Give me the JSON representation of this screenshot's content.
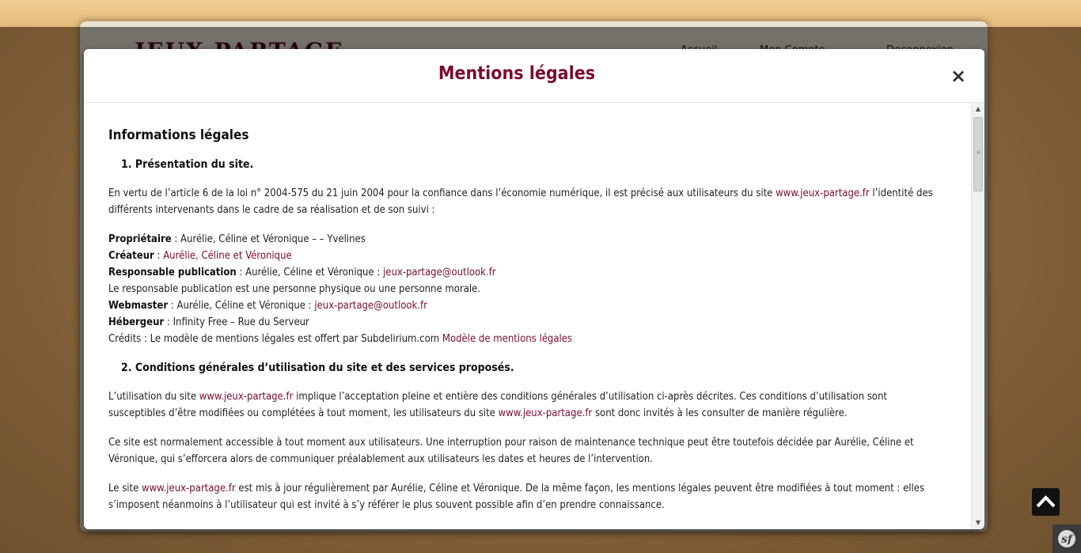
{
  "background": {
    "logo_text": "JEUX PARTAGE",
    "nav": [
      "Accueil",
      "Mon Compte",
      "Deconnexion"
    ]
  },
  "modal": {
    "title": "Mentions légales",
    "close_label": "×",
    "heading": "Informations légales",
    "sections": [
      {
        "title": "1. Présentation du site."
      },
      {
        "title": "2. Conditions générales d’utilisation du site et des services proposés."
      }
    ],
    "s1": {
      "intro_pre": "En vertu de l’article 6 de la loi n° 2004-575 du 21 juin 2004 pour la confiance dans l’économie numérique, il est précisé aux utilisateurs du site ",
      "intro_link": "www.jeux-partage.fr",
      "intro_post": " l’identité des différents intervenants dans le cadre de sa réalisation et de son suivi :",
      "proprietaire_label": "Propriétaire",
      "proprietaire_value": " : Aurélie, Céline et Véronique – – Yvelines",
      "createur_label": "Créateur",
      "createur_sep": " : ",
      "createur_link": "Aurélie, Céline et Véronique",
      "responsable_label": "Responsable publication",
      "responsable_value": " : Aurélie, Céline et Véronique : ",
      "responsable_link": "jeux-partage@outlook.fr",
      "responsable_note": "Le responsable publication est une personne physique ou une personne morale.",
      "webmaster_label": "Webmaster",
      "webmaster_value": " : Aurélie, Céline et Véronique : ",
      "webmaster_link": "jeux-partage@outlook.fr",
      "hebergeur_label": "Hébergeur",
      "hebergeur_value": " : Infinity Free – Rue du Serveur",
      "credits_text": "Crédits : Le modèle de mentions légales est offert par Subdelirium.com ",
      "credits_link": "Modèle de mentions légales"
    },
    "s2": {
      "p1_a": "L’utilisation du site ",
      "p1_link1": "www.jeux-partage.fr",
      "p1_b": " implique l’acceptation pleine et entière des conditions générales d’utilisation ci-après décrites. Ces conditions d’utilisation sont susceptibles d’être modifiées ou complétées à tout moment, les utilisateurs du site ",
      "p1_link2": "www.jeux-partage.fr",
      "p1_c": " sont donc invités à les consulter de manière régulière.",
      "p2": "Ce site est normalement accessible à tout moment aux utilisateurs. Une interruption pour raison de maintenance technique peut être toutefois décidée par Aurélie, Céline et Véronique, qui s’efforcera alors de communiquer préalablement aux utilisateurs les dates et heures de l’intervention.",
      "p3_a": "Le site ",
      "p3_link": "www.jeux-partage.fr",
      "p3_b": " est mis à jour régulièrement par Aurélie, Céline et Véronique. De la même façon, les mentions légales peuvent être modifiées à tout moment : elles s’imposent néanmoins à l’utilisateur qui est invité à s’y référer le plus souvent possible afin d’en prendre connaissance."
    }
  },
  "colors": {
    "accent": "#7a0c2e",
    "text": "#222222"
  },
  "icons": {
    "close": "close-icon",
    "back_to_top": "chevron-up-icon",
    "debug": "symfony-icon"
  }
}
